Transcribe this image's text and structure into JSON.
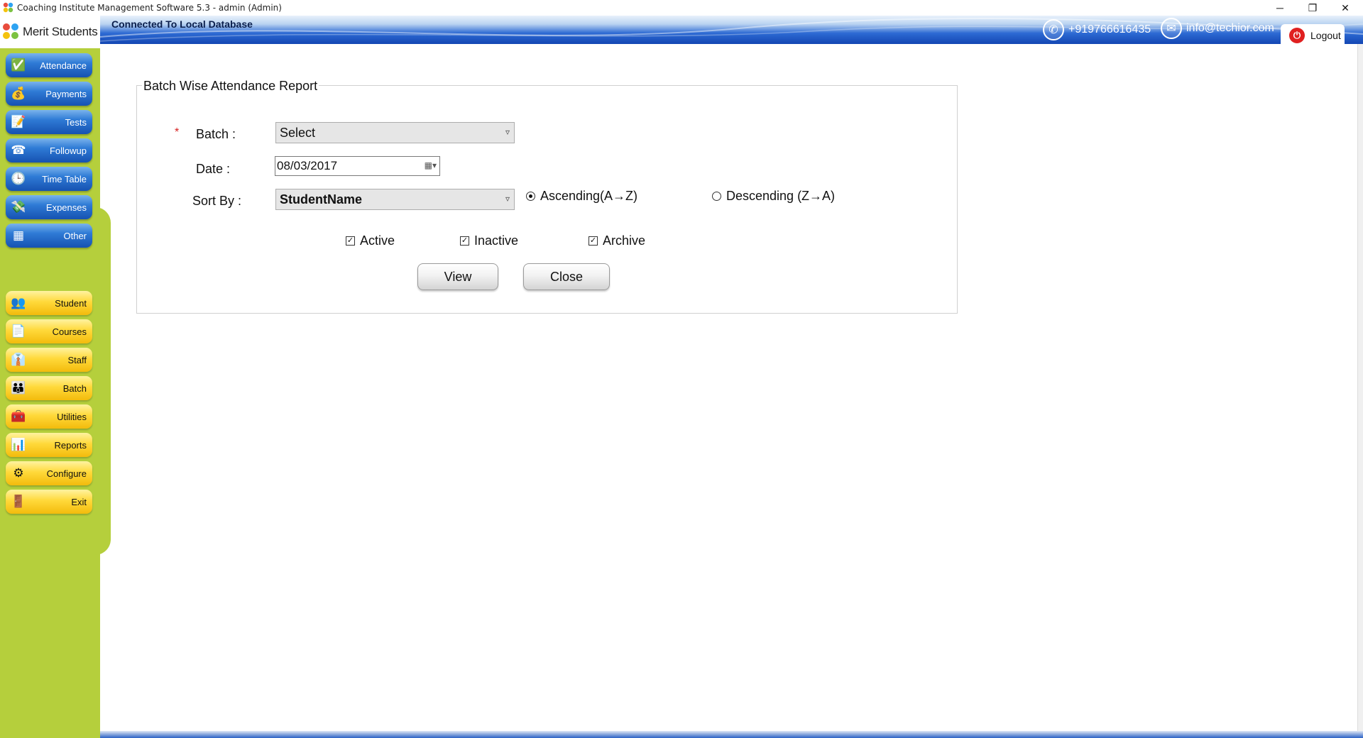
{
  "window": {
    "title": "Coaching Institute Management Software 5.3  -  admin (Admin)",
    "controls": {
      "minimize": "─",
      "restore": "❐",
      "close": "✕"
    }
  },
  "banner": {
    "connection": "Connected To  Local Database",
    "phone": "+919766616435",
    "email": "info@techior.com",
    "logout": "Logout"
  },
  "sidebar": {
    "brand": "Merit Students",
    "top_items": [
      {
        "label": "Attendance",
        "icon": "attendance-icon"
      },
      {
        "label": "Payments",
        "icon": "payments-icon"
      },
      {
        "label": "Tests",
        "icon": "tests-icon"
      },
      {
        "label": "Followup",
        "icon": "followup-icon"
      },
      {
        "label": "Time Table",
        "icon": "clock-icon"
      },
      {
        "label": "Expenses",
        "icon": "expenses-icon"
      },
      {
        "label": "Other",
        "icon": "grid-icon"
      }
    ],
    "bottom_items": [
      {
        "label": "Student",
        "icon": "students-icon"
      },
      {
        "label": "Courses",
        "icon": "document-icon"
      },
      {
        "label": "Staff",
        "icon": "staff-icon"
      },
      {
        "label": "Batch",
        "icon": "batch-icon"
      },
      {
        "label": "Utilities",
        "icon": "utilities-icon"
      },
      {
        "label": "Reports",
        "icon": "reports-icon"
      },
      {
        "label": "Configure",
        "icon": "gear-icon"
      },
      {
        "label": "Exit",
        "icon": "exit-icon"
      }
    ]
  },
  "form": {
    "title": "Batch Wise Attendance Report",
    "required_mark": "*",
    "batch_label": "Batch :",
    "batch_value": "Select",
    "date_label": "Date :",
    "date_value": "08/03/2017",
    "sort_label": "Sort By :",
    "sort_value": "StudentName",
    "ascending": {
      "label": "Ascending(A→Z)",
      "selected": true
    },
    "descending": {
      "label": "Descending (Z→A)",
      "selected": false
    },
    "filters": [
      {
        "label": "Active",
        "checked": true
      },
      {
        "label": "Inactive",
        "checked": true
      },
      {
        "label": "Archive",
        "checked": true
      }
    ],
    "view_button": "View",
    "close_button": "Close"
  }
}
